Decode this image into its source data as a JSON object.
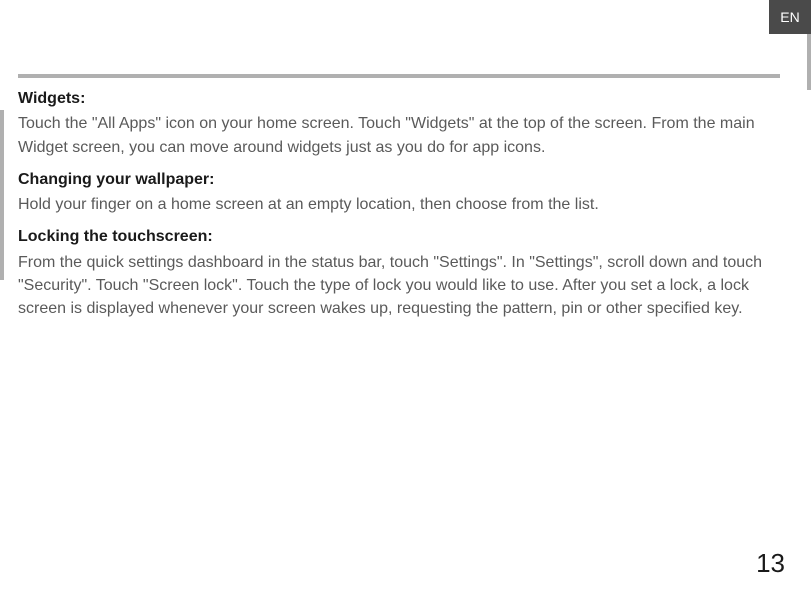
{
  "lang_tab": "EN",
  "sections": {
    "widgets": {
      "heading": "Widgets:",
      "body": "Touch the \"All Apps\" icon on your home screen. Touch \"Widgets\" at the top of the screen. From the main Widget screen, you can move around widgets just as you do for app icons."
    },
    "wallpaper": {
      "heading": "Changing your wallpaper:",
      "body": "Hold your finger on a home screen at an empty location, then choose from the list."
    },
    "locking": {
      "heading": "Locking the touchscreen:",
      "body": "From the quick settings dashboard in the status bar, touch \"Settings\". In \"Settings\", scroll down and touch \"Security\". Touch \"Screen lock\". Touch the type of lock you would like to use. After you set a lock, a lock screen is displayed whenever your screen wakes up, requesting the pattern, pin or other specified key."
    }
  },
  "page_number": "13"
}
